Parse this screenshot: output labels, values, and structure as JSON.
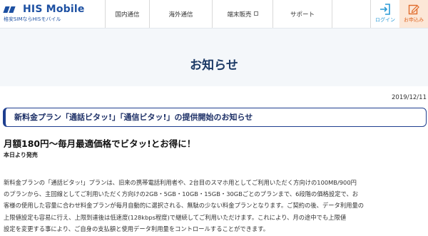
{
  "header": {
    "logo_text": "HIS Mobile",
    "logo_tagline": "格安SIMならHISモバイル",
    "brand_color": "#1d50a2",
    "nav": [
      {
        "label": "国内通信"
      },
      {
        "label": "海外通信"
      },
      {
        "label": "端末販売",
        "icon": "external-link-icon"
      },
      {
        "label": "サポート"
      }
    ],
    "login_label": "ログイン",
    "login_icon": "login-arrow-icon",
    "apply_label": "お申込み",
    "apply_icon": "pencil-edit-icon",
    "apply_color": "#e06b2a"
  },
  "page": {
    "title": "お知らせ",
    "date": "2019/12/11",
    "notice_title": "新料金プラン「通話ビタッ!」「通信ビタッ!」の提供開始のお知らせ",
    "headline": "月額180円～毎月最適価格でビタッ!とお得に！",
    "subline": "本日より発売",
    "body_lines": [
      "新料金プランの「通話ビタッ!」プランは、旧来の携帯電話利用者や、2台目のスマホ用としてご利用いただく方向けの100MB/900円",
      "のプランから、主回線としてご利用いただく方向けの2GB・5GB・10GB・15GB・30GBごとのプランまで、6段階の価格設定で、お",
      "客様の使用した容量に合わせ料金プランが毎月自動的に選択される、無駄の少ない料金プランとなります。ご契約の後、データ利用量の",
      "上限値設定も容易に行え、上限到達後は低速度(128kbps程度)で継続してご利用いただけます。これにより、月の途中でも上限値",
      "設定を変更する事により、ご自身の支払額と使用データ利用量をコントロールすることができます。"
    ]
  }
}
